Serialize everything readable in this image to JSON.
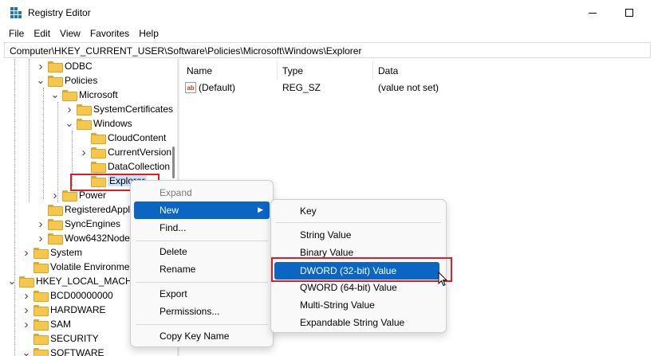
{
  "window": {
    "title": "Registry Editor"
  },
  "menubar": [
    "File",
    "Edit",
    "View",
    "Favorites",
    "Help"
  ],
  "address": "Computer\\HKEY_CURRENT_USER\\Software\\Policies\\Microsoft\\Windows\\Explorer",
  "tree": [
    {
      "label": "ODBC",
      "indent": 2,
      "chevron": "right"
    },
    {
      "label": "Policies",
      "indent": 2,
      "chevron": "down"
    },
    {
      "label": "Microsoft",
      "indent": 3,
      "chevron": "down"
    },
    {
      "label": "SystemCertificates",
      "indent": 4,
      "chevron": "right"
    },
    {
      "label": "Windows",
      "indent": 4,
      "chevron": "down"
    },
    {
      "label": "CloudContent",
      "indent": 5,
      "chevron": ""
    },
    {
      "label": "CurrentVersion",
      "indent": 5,
      "chevron": "right"
    },
    {
      "label": "DataCollection",
      "indent": 5,
      "chevron": ""
    },
    {
      "label": "Explorer",
      "indent": 5,
      "chevron": "",
      "selected": true
    },
    {
      "label": "Power",
      "indent": 3,
      "chevron": "right"
    },
    {
      "label": "RegisteredApplica",
      "indent": 2,
      "chevron": ""
    },
    {
      "label": "SyncEngines",
      "indent": 2,
      "chevron": "right"
    },
    {
      "label": "Wow6432Node",
      "indent": 2,
      "chevron": "right"
    },
    {
      "label": "System",
      "indent": 1,
      "chevron": "right"
    },
    {
      "label": "Volatile Environment",
      "indent": 1,
      "chevron": ""
    },
    {
      "label": "HKEY_LOCAL_MACHIN",
      "indent": 0,
      "chevron": "down"
    },
    {
      "label": "BCD00000000",
      "indent": 1,
      "chevron": "right"
    },
    {
      "label": "HARDWARE",
      "indent": 1,
      "chevron": "right"
    },
    {
      "label": "SAM",
      "indent": 1,
      "chevron": "right"
    },
    {
      "label": "SECURITY",
      "indent": 1,
      "chevron": ""
    },
    {
      "label": "SOFTWARE",
      "indent": 1,
      "chevron": "down"
    }
  ],
  "list": {
    "columns": [
      "Name",
      "Type",
      "Data"
    ],
    "rows": [
      {
        "name": "(Default)",
        "type": "REG_SZ",
        "data": "(value not set)",
        "icon": "string-value-icon"
      }
    ]
  },
  "context_menu": {
    "expand": "Expand",
    "new": "New",
    "find": "Find...",
    "delete": "Delete",
    "rename": "Rename",
    "export": "Export",
    "permissions": "Permissions...",
    "copy_key_name": "Copy Key Name"
  },
  "submenu": {
    "key": "Key",
    "string_value": "String Value",
    "binary_value": "Binary Value",
    "dword_value": "DWORD (32-bit) Value",
    "qword_value": "QWORD (64-bit) Value",
    "multi_string_value": "Multi-String Value",
    "expandable_string_value": "Expandable String Value"
  },
  "colors": {
    "highlight": "#0a66c2",
    "annotation": "#d9202a",
    "folder": "#f5c84c",
    "selection": "#cce4f7"
  }
}
